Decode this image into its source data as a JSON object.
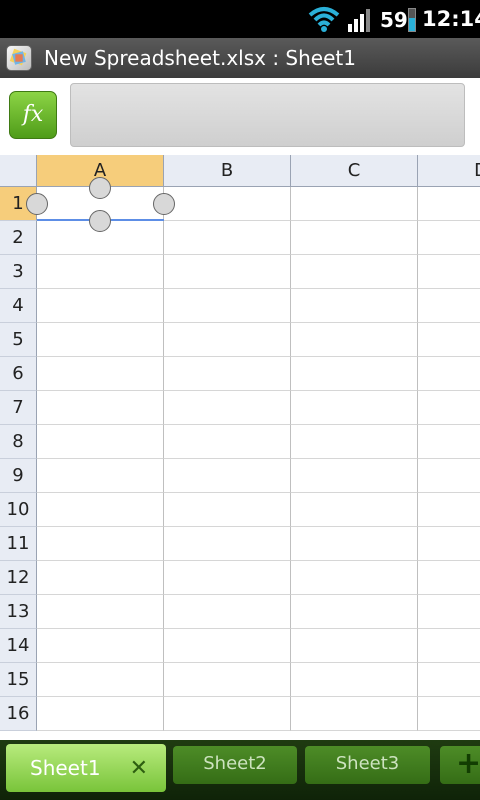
{
  "status_bar": {
    "battery_level": "59",
    "time": "12:14"
  },
  "title_bar": {
    "title": "New Spreadsheet.xlsx : Sheet1",
    "app_icon": "spreadsheet-app-icon"
  },
  "formula_bar": {
    "fx_label": "fx",
    "value": ""
  },
  "grid": {
    "columns": [
      "A",
      "B",
      "C",
      "D"
    ],
    "selected_column": "A",
    "rows": [
      "1",
      "2",
      "3",
      "4",
      "5",
      "6",
      "7",
      "8",
      "9",
      "10",
      "11",
      "12",
      "13",
      "14",
      "15",
      "16"
    ],
    "selected_row": "1",
    "selected_cell": "A1"
  },
  "sheet_tabs": {
    "tabs": [
      {
        "label": "Sheet1",
        "active": true
      },
      {
        "label": "Sheet2",
        "active": false
      },
      {
        "label": "Sheet3",
        "active": false
      }
    ],
    "close_icon": "close-icon",
    "add_icon": "plus-icon"
  },
  "colors": {
    "selection_highlight": "#f6cd7b",
    "selection_border": "#5d8ee6",
    "tab_active": "#79c43a",
    "tab_inactive": "#356d16"
  }
}
